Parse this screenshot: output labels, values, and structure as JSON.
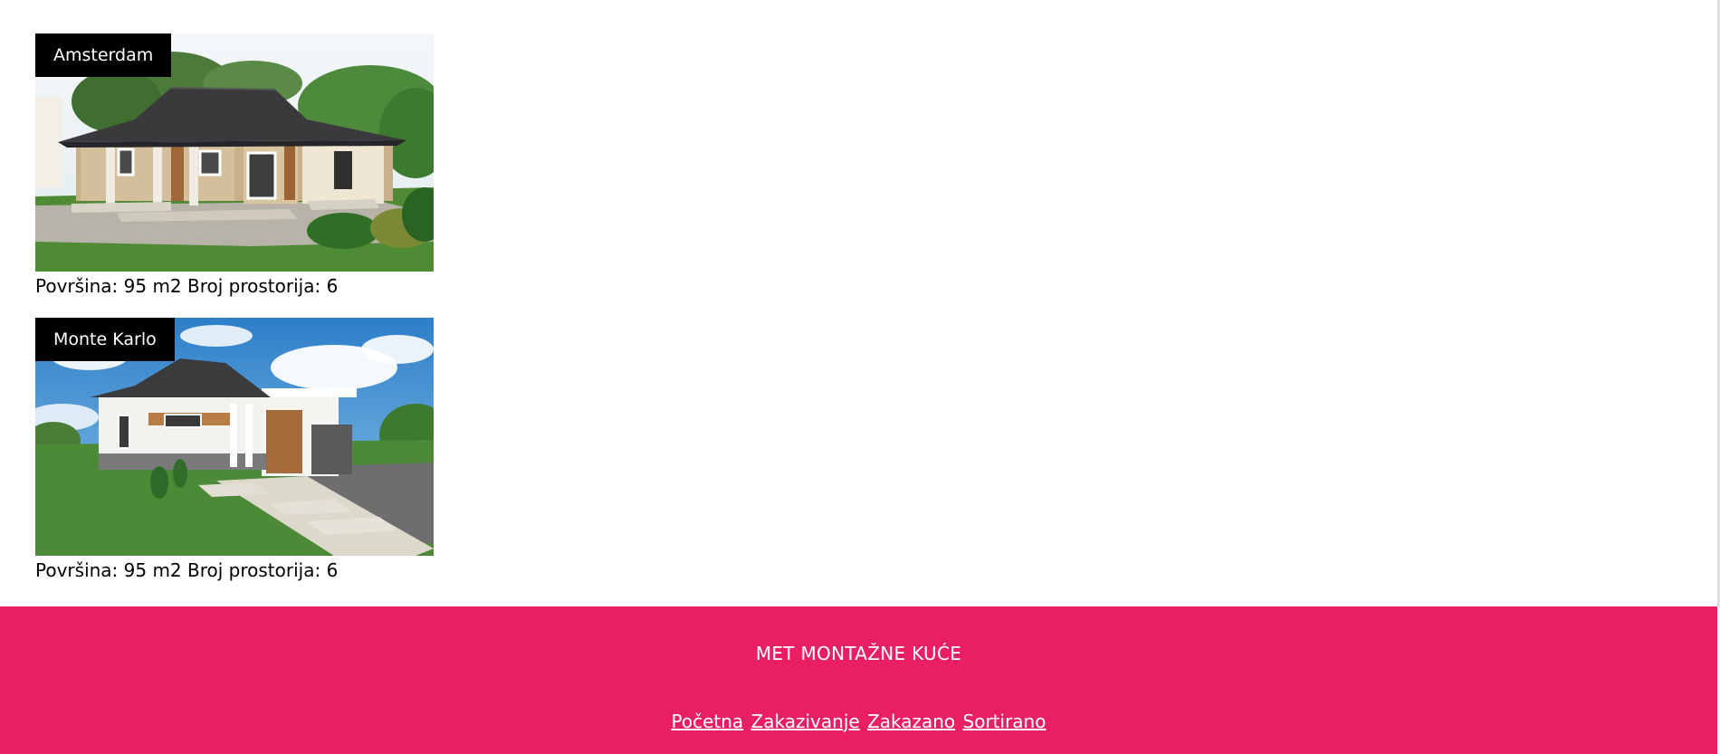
{
  "colors": {
    "footer_bg": "#e91e63",
    "label_bg": "#000000",
    "footer_text": "#ffffff"
  },
  "houses": [
    {
      "name": "Amsterdam",
      "meta": "Površina: 95 m2 Broj prostorija: 6",
      "image": "house-render-amsterdam"
    },
    {
      "name": "Monte Karlo",
      "meta": "Površina: 95 m2 Broj prostorija: 6",
      "image": "house-render-monte-karlo"
    }
  ],
  "footer": {
    "title": "MET MONTAŽNE KUĆE",
    "nav": [
      {
        "label": "Početna"
      },
      {
        "label": "Zakazivanje"
      },
      {
        "label": "Zakazano"
      },
      {
        "label": "Sortirano"
      }
    ]
  }
}
